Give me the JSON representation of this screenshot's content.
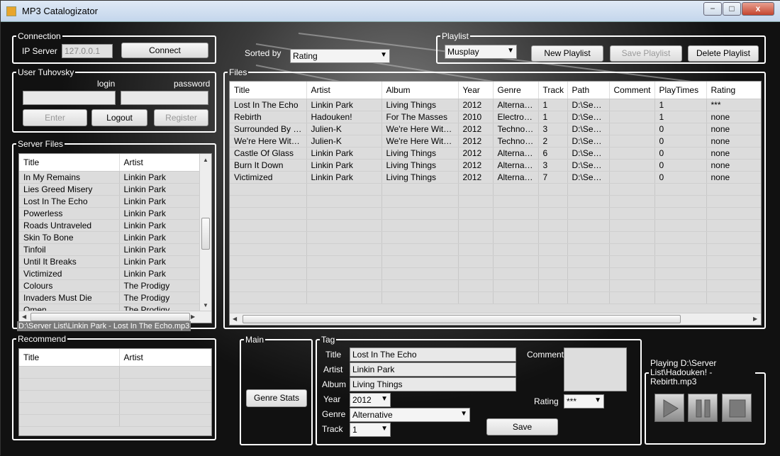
{
  "window": {
    "title": "MP3 Catalogizator",
    "min": "−",
    "max": "□",
    "close": "x"
  },
  "connection": {
    "legend": "Connection",
    "ip_label": "IP Server",
    "ip_value": "127.0.0.1",
    "connect": "Connect"
  },
  "user": {
    "legend": "User Tuhovsky",
    "login_label": "login",
    "password_label": "password",
    "enter": "Enter",
    "logout": "Logout",
    "register": "Register"
  },
  "server_files": {
    "legend": "Server Files",
    "columns": [
      "Title",
      "Artist"
    ],
    "rows": [
      [
        "In My Remains",
        "Linkin Park"
      ],
      [
        "Lies Greed Misery",
        "Linkin Park"
      ],
      [
        "Lost In The Echo",
        "Linkin Park"
      ],
      [
        "Powerless",
        "Linkin Park"
      ],
      [
        "Roads Untraveled",
        "Linkin Park"
      ],
      [
        "Skin To Bone",
        "Linkin Park"
      ],
      [
        "Tinfoil",
        "Linkin Park"
      ],
      [
        "Until It Breaks",
        "Linkin Park"
      ],
      [
        "Victimized",
        "Linkin Park"
      ],
      [
        "Colours",
        "The Prodigy"
      ],
      [
        "Invaders Must Die",
        "The Prodigy"
      ],
      [
        "Omen",
        "The Prodigy"
      ]
    ],
    "status": "D:\\Server List\\Linkin Park - Lost In The Echo.mp3"
  },
  "recommend": {
    "legend": "Recommend",
    "columns": [
      "Title",
      "Artist"
    ]
  },
  "sorted_by": {
    "label": "Sorted by",
    "value": "Rating"
  },
  "playlist": {
    "legend": "Playlist",
    "value": "Musplay",
    "new": "New Playlist",
    "save": "Save Playlist",
    "delete": "Delete Playlist"
  },
  "files": {
    "legend": "Files",
    "columns": [
      "Title",
      "Artist",
      "Album",
      "Year",
      "Genre",
      "Track",
      "Path",
      "Comment",
      "PlayTimes",
      "Rating"
    ],
    "rows": [
      [
        "Lost In The Echo",
        "Linkin Park",
        "Living Things",
        "2012",
        "Alternative",
        "1",
        "D:\\Serv...",
        "",
        "1",
        "***"
      ],
      [
        "Rebirth",
        "Hadouken!",
        "For The Masses",
        "2010",
        "Electronic",
        "1",
        "D:\\Serv...",
        "",
        "1",
        "none"
      ],
      [
        "Surrounded By Co...",
        "Julien-K",
        "We're Here With ...",
        "2012",
        "Technol...",
        "3",
        "D:\\Serv...",
        "",
        "0",
        "none"
      ],
      [
        "We're Here With Y...",
        "Julien-K",
        "We're Here With ...",
        "2012",
        "Technol...",
        "2",
        "D:\\Serv...",
        "",
        "0",
        "none"
      ],
      [
        "Castle Of Glass",
        "Linkin Park",
        "Living Things",
        "2012",
        "Alternative",
        "6",
        "D:\\Serv...",
        "",
        "0",
        "none"
      ],
      [
        "Burn It Down",
        "Linkin Park",
        "Living Things",
        "2012",
        "Alternative",
        "3",
        "D:\\Serv...",
        "",
        "0",
        "none"
      ],
      [
        "Victimized",
        "Linkin Park",
        "Living Things",
        "2012",
        "Alternative",
        "7",
        "D:\\Serv...",
        "",
        "0",
        "none"
      ]
    ]
  },
  "main": {
    "legend": "Main",
    "genre_stats": "Genre Stats"
  },
  "tag": {
    "legend": "Tag",
    "title_label": "Title",
    "title_value": "Lost In The Echo",
    "artist_label": "Artist",
    "artist_value": "Linkin Park",
    "album_label": "Album",
    "album_value": "Living Things",
    "year_label": "Year",
    "year_value": "2012",
    "genre_label": "Genre",
    "genre_value": "Alternative",
    "track_label": "Track",
    "track_value": "1",
    "comment_label": "Comment",
    "rating_label": "Rating",
    "rating_value": "***",
    "save": "Save"
  },
  "player": {
    "legend": "Playing D:\\Server List\\Hadouken! - Rebirth.mp3"
  }
}
